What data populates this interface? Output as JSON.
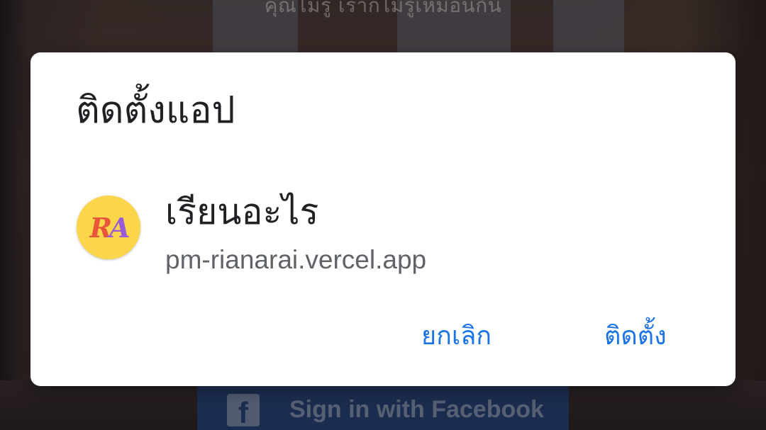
{
  "background": {
    "top_text": "คุณไม่รู้ เราก็ไม่รู้เหมือนกัน",
    "facebook_button": {
      "icon": "facebook-icon",
      "glyph": "f",
      "label": "Sign in with Facebook",
      "color": "#27457c"
    }
  },
  "dialog": {
    "title": "ติดตั้งแอป",
    "app": {
      "icon": {
        "letter_1": "R",
        "letter_2": "A",
        "background_color": "#fbd54a"
      },
      "name": "เรียนอะไร",
      "url": "pm-rianarai.vercel.app"
    },
    "buttons": {
      "cancel": "ยกเลิก",
      "install": "ติดตั้ง"
    },
    "accent_color": "#1a73e8"
  }
}
